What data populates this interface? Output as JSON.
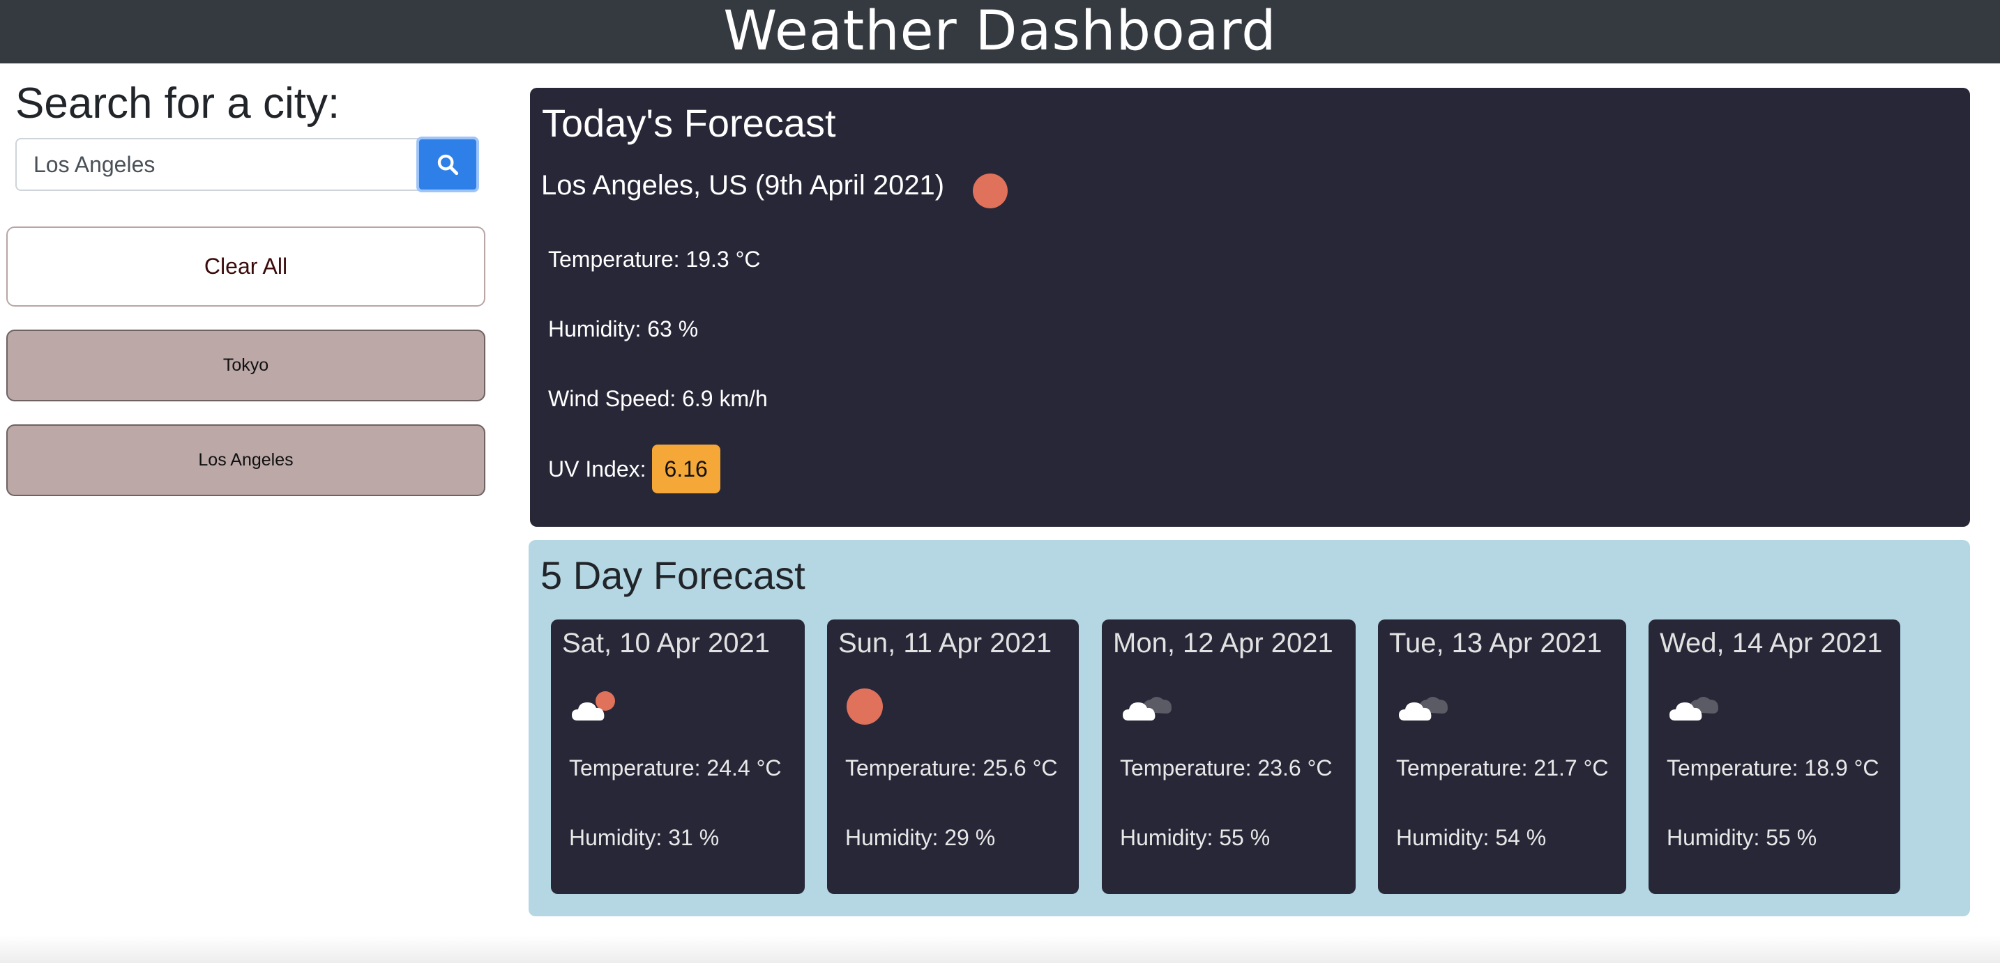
{
  "header": {
    "title": "Weather Dashboard"
  },
  "sidebar": {
    "heading": "Search for a city:",
    "search": {
      "value": "Los Angeles",
      "placeholder": ""
    },
    "search_icon": "search-icon",
    "clear_label": "Clear All",
    "history": [
      {
        "label": "Tokyo"
      },
      {
        "label": "Los Angeles"
      }
    ]
  },
  "today": {
    "title": "Today's Forecast",
    "city_line": "Los Angeles, US (9th April 2021)",
    "icon": "sun-icon",
    "temperature": "Temperature: 19.3 °C",
    "humidity": "Humidity: 63 %",
    "wind": "Wind Speed: 6.9 km/h",
    "uv_label": "UV Index:",
    "uv_value": "6.16",
    "uv_color": "#f5a738"
  },
  "forecast": {
    "title": "5 Day Forecast",
    "days": [
      {
        "date": "Sat, 10 Apr 2021",
        "icon": "partly-cloudy-sun-icon",
        "temp": "Temperature: 24.4 °C",
        "humidity": "Humidity: 31 %"
      },
      {
        "date": "Sun, 11 Apr 2021",
        "icon": "sun-icon",
        "temp": "Temperature: 25.6 °C",
        "humidity": "Humidity: 29 %"
      },
      {
        "date": "Mon, 12 Apr 2021",
        "icon": "cloudy-icon",
        "temp": "Temperature: 23.6 °C",
        "humidity": "Humidity: 55 %"
      },
      {
        "date": "Tue, 13 Apr 2021",
        "icon": "cloudy-icon",
        "temp": "Temperature: 21.7 °C",
        "humidity": "Humidity: 54 %"
      },
      {
        "date": "Wed, 14 Apr 2021",
        "icon": "cloudy-icon",
        "temp": "Temperature: 18.9 °C",
        "humidity": "Humidity: 55 %"
      }
    ]
  },
  "colors": {
    "header_bg": "#343a40",
    "panel_dark": "#272738",
    "forecast_bg": "#b4d7e3",
    "search_button": "#2f7fe8",
    "history_bg": "#bba8a7",
    "sun": "#e0715a"
  }
}
